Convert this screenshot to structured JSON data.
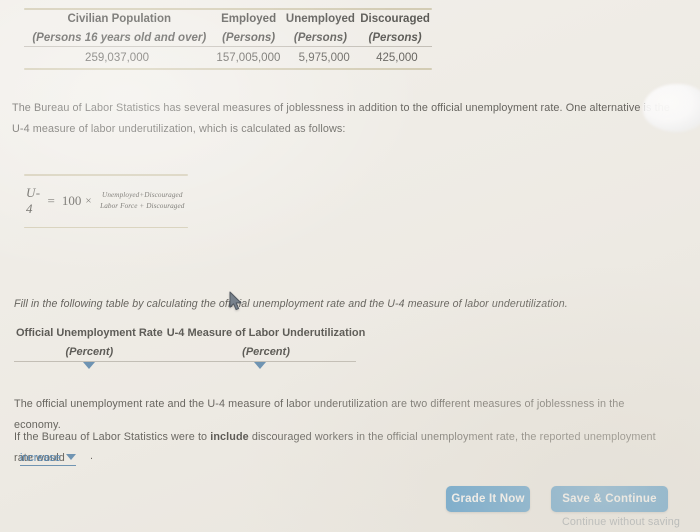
{
  "labor_table": {
    "headers": [
      {
        "title": "Civilian Population",
        "sub": "(Persons 16 years old and over)"
      },
      {
        "title": "Employed",
        "sub": "(Persons)"
      },
      {
        "title": "Unemployed",
        "sub": "(Persons)"
      },
      {
        "title": "Discouraged",
        "sub": "(Persons)"
      }
    ],
    "row": [
      "259,037,000",
      "157,005,000",
      "5,975,000",
      "425,000"
    ]
  },
  "intro_paragraph": "The Bureau of Labor Statistics has several measures of joblessness in addition to the official unemployment rate. One alternative is the U-4 measure of labor underutilization, which is calculated as follows:",
  "formula": {
    "lhs": "U-4",
    "equals": "=",
    "coefficient": "100",
    "times": "×",
    "numerator": "Unemployed+Discouraged",
    "denominator": "Labor Force + Discouraged"
  },
  "fill_prompt": "Fill in the following table by calculating the official unemployment rate and the U-4 measure of labor underutilization.",
  "answer_table": {
    "headers": [
      {
        "title": "Official Unemployment Rate",
        "sub": "(Percent)"
      },
      {
        "title": "U-4 Measure of Labor Underutilization",
        "sub": "(Percent)"
      }
    ],
    "cells": [
      "",
      ""
    ]
  },
  "summary_paragraph": "The official unemployment rate and the U-4 measure of labor underutilization are two different measures of joblessness in the economy.",
  "include_sentence": {
    "before": "If the Bureau of Labor Statistics were to ",
    "emphasis": "include",
    "after": " discouraged workers in the official unemployment rate, the reported unemployment rate would"
  },
  "inline_dropdown": {
    "value": "increase",
    "trailing_punctuation": "."
  },
  "buttons": {
    "grade": "Grade It Now",
    "save_continue": "Save & Continue",
    "continue_without_saving": "Continue without saving"
  },
  "colors": {
    "button_blue": "#1c7fc4",
    "link_blue": "#2f6fa8",
    "dropdown_blue": "#4f7fa8",
    "rule_tan": "#c9c2a4",
    "page_background": "#efece6",
    "muted_text": "#7d8993"
  }
}
